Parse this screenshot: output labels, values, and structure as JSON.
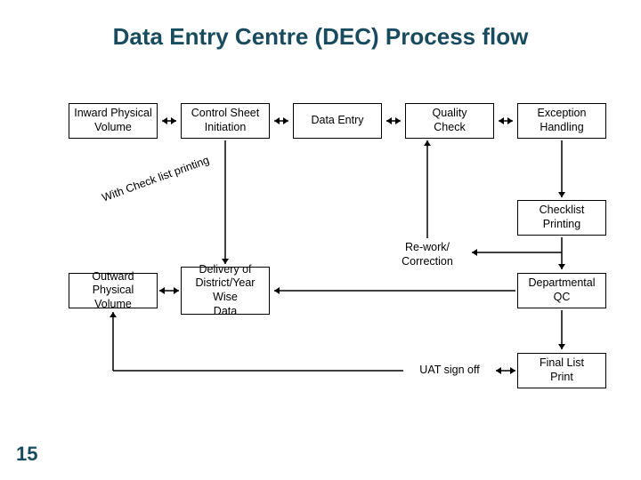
{
  "title": "Data Entry Centre (DEC) Process flow",
  "slide_number": "15",
  "annotation": "With Check list printing",
  "boxes": {
    "inward_physical_volume": "Inward Physical\nVolume",
    "control_sheet_initiation": "Control Sheet\nInitiation",
    "data_entry": "Data Entry",
    "quality_check": "Quality\nCheck",
    "exception_handling": "Exception\nHandling",
    "checklist_printing": "Checklist\nPrinting",
    "outward_physical_volume": "Outward Physical\nVolume",
    "delivery_district_year": "Delivery of\nDistrict/Year Wise\nData",
    "departmental_qc": "Departmental QC",
    "final_list_print": "Final List\nPrint"
  },
  "labels": {
    "rework_correction": "Re-work/\nCorrection",
    "uat_sign_off": "UAT sign off"
  }
}
